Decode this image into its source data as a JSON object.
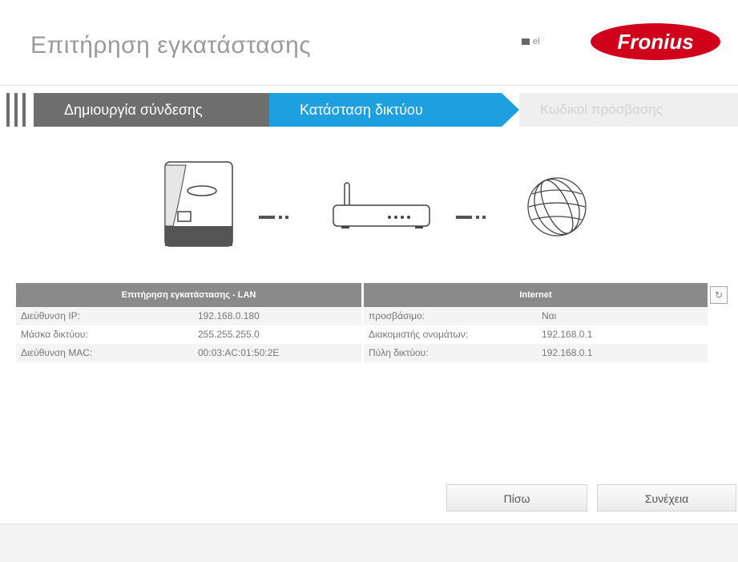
{
  "header": {
    "title": "Επιτήρηση εγκατάστασης",
    "language_code": "el",
    "brand": "Fronius"
  },
  "steps": [
    {
      "label": "Δημιουργία σύνδεσης",
      "state": "done"
    },
    {
      "label": "Κατάσταση δικτύου",
      "state": "active"
    },
    {
      "label": "Κωδικοί πρόσβασης",
      "state": "pending"
    }
  ],
  "diagram": {
    "icons": [
      "inverter-icon",
      "router-icon",
      "globe-icon"
    ]
  },
  "lan": {
    "header": "Επιτήρηση εγκατάστασης - LAN",
    "rows": [
      {
        "label": "Διεύθυνση IP:",
        "value": "192.168.0.180"
      },
      {
        "label": "Μάσκα δικτύου:",
        "value": "255.255.255.0"
      },
      {
        "label": "Διεύθυνση MAC:",
        "value": "00:03:AC:01:50:2E"
      }
    ]
  },
  "internet": {
    "header": "Internet",
    "rows": [
      {
        "label": "προσβάσιμο:",
        "value": "Ναι"
      },
      {
        "label": "Διακομιστής ονομάτων:",
        "value": "192.168.0.1"
      },
      {
        "label": "Πύλη δικτύου:",
        "value": "192.168.0.1"
      }
    ]
  },
  "buttons": {
    "back": "Πίσω",
    "next": "Συνέχεια"
  },
  "colors": {
    "active_step": "#1e9fe0",
    "done_step": "#6e6e6e",
    "brand_red": "#d0021b"
  }
}
